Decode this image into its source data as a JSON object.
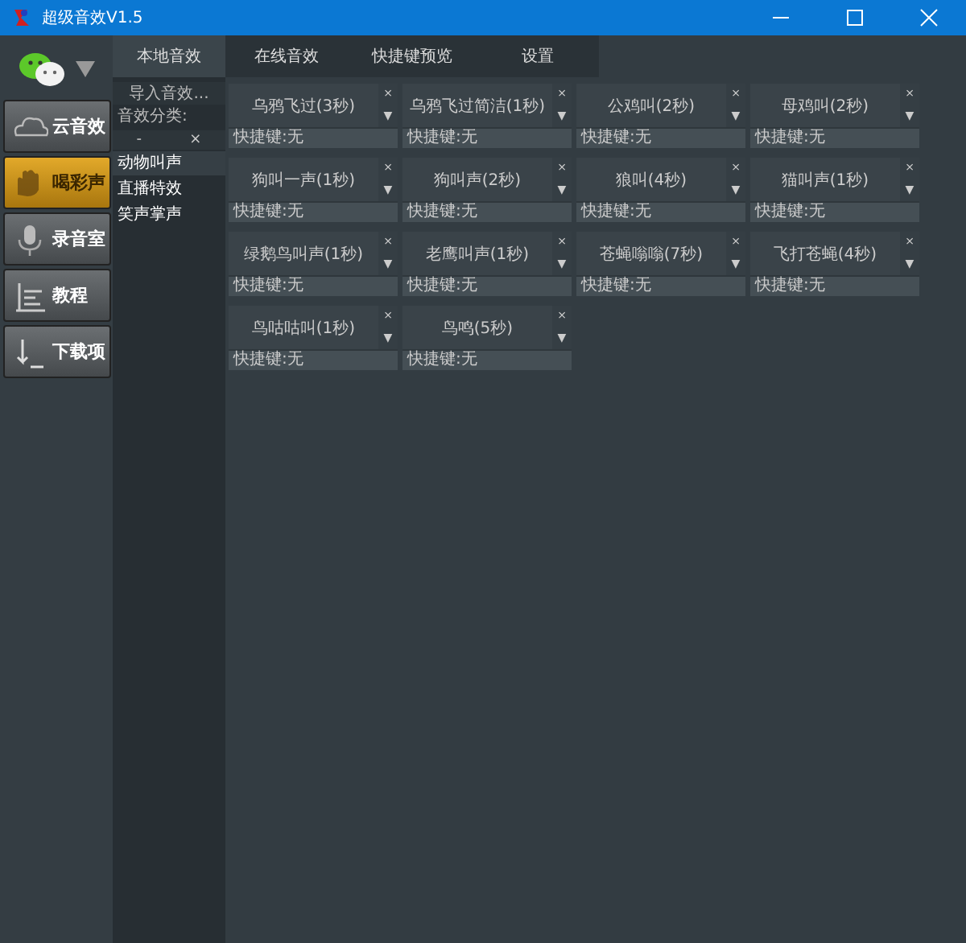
{
  "window": {
    "title": "超级音效V1.5"
  },
  "nav": [
    {
      "label": "云音效",
      "selected": false
    },
    {
      "label": "喝彩声",
      "selected": true
    },
    {
      "label": "录音室",
      "selected": false
    },
    {
      "label": "教程",
      "selected": false
    },
    {
      "label": "下载项",
      "selected": false
    }
  ],
  "tabs": [
    {
      "label": "本地音效",
      "selected": true
    },
    {
      "label": "在线音效",
      "selected": false
    },
    {
      "label": "快捷键预览",
      "selected": false
    },
    {
      "label": "设置",
      "selected": false
    }
  ],
  "category_panel": {
    "import_button": "导入音效...",
    "heading": "音效分类:",
    "remove_button": "-",
    "close_button": "×",
    "items": [
      {
        "label": "动物叫声",
        "selected": true
      },
      {
        "label": "直播特效",
        "selected": false
      },
      {
        "label": "笑声掌声",
        "selected": false
      }
    ]
  },
  "sounds": [
    {
      "name": "乌鸦飞过(3秒)",
      "shortcut": "快捷键:无",
      "delete": "×",
      "menu": "▼"
    },
    {
      "name": "乌鸦飞过简洁(1秒)",
      "shortcut": "快捷键:无",
      "delete": "×",
      "menu": "▼"
    },
    {
      "name": "公鸡叫(2秒)",
      "shortcut": "快捷键:无",
      "delete": "×",
      "menu": "▼"
    },
    {
      "name": "母鸡叫(2秒)",
      "shortcut": "快捷键:无",
      "delete": "×",
      "menu": "▼"
    },
    {
      "name": "狗叫一声(1秒)",
      "shortcut": "快捷键:无",
      "delete": "×",
      "menu": "▼"
    },
    {
      "name": "狗叫声(2秒)",
      "shortcut": "快捷键:无",
      "delete": "×",
      "menu": "▼"
    },
    {
      "name": "狼叫(4秒)",
      "shortcut": "快捷键:无",
      "delete": "×",
      "menu": "▼"
    },
    {
      "name": "猫叫声(1秒)",
      "shortcut": "快捷键:无",
      "delete": "×",
      "menu": "▼"
    },
    {
      "name": "绿鹅鸟叫声(1秒)",
      "shortcut": "快捷键:无",
      "delete": "×",
      "menu": "▼"
    },
    {
      "name": "老鹰叫声(1秒)",
      "shortcut": "快捷键:无",
      "delete": "×",
      "menu": "▼"
    },
    {
      "name": "苍蝇嗡嗡(7秒)",
      "shortcut": "快捷键:无",
      "delete": "×",
      "menu": "▼"
    },
    {
      "name": "飞打苍蝇(4秒)",
      "shortcut": "快捷键:无",
      "delete": "×",
      "menu": "▼"
    },
    {
      "name": "鸟咕咕叫(1秒)",
      "shortcut": "快捷键:无",
      "delete": "×",
      "menu": "▼"
    },
    {
      "name": "鸟鸣(5秒)",
      "shortcut": "快捷键:无",
      "delete": "×",
      "menu": "▼"
    }
  ]
}
